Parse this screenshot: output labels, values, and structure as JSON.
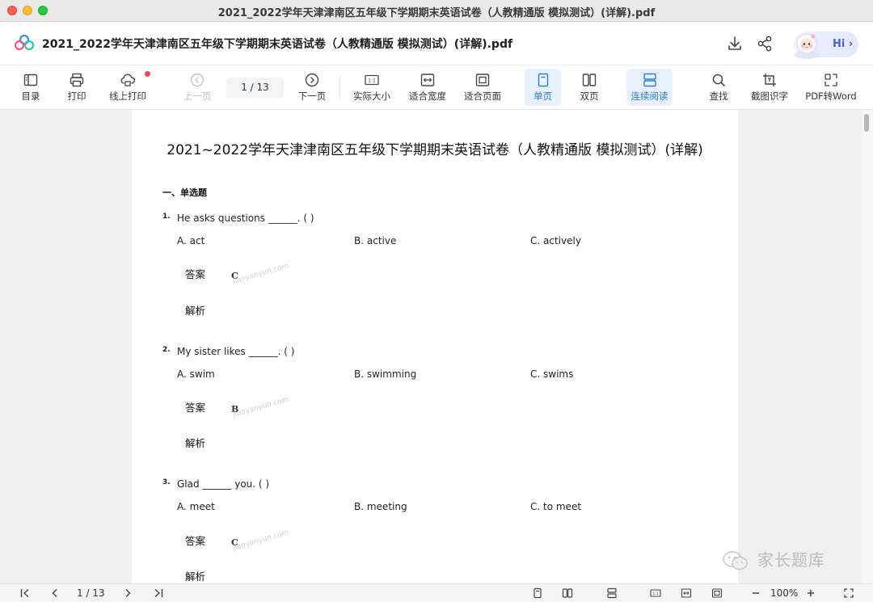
{
  "window": {
    "title": "2021_2022学年天津津南区五年级下学期期末英语试卷（人教精通版 模拟测试）(详解).pdf"
  },
  "header": {
    "doc_title": "2021_2022学年天津津南区五年级下学期期末英语试卷（人教精通版 模拟测试）(详解).pdf",
    "hi_label": "Hi",
    "hi_chevron": "›"
  },
  "toolbar": {
    "catalog": "目录",
    "print": "打印",
    "online_print": "线上打印",
    "prev_page": "上一页",
    "page_indicator": "1   /  13",
    "next_page": "下一页",
    "actual_size": "实际大小",
    "fit_width": "适合宽度",
    "fit_page": "适合页面",
    "single_page": "单页",
    "double_page": "双页",
    "continuous": "连续阅读",
    "find": "查找",
    "ocr": "截图识字",
    "pdf_to_word": "PDF转Word"
  },
  "document": {
    "title": "2021~2022学年天津津南区五年级下学期期末英语试卷（人教精通版 模拟测试）(详解)",
    "section": "一、单选题",
    "answer_label": "答案",
    "analysis_label": "解析",
    "watermark": "jiaoyanyun.com",
    "questions": [
      {
        "num": "1.",
        "text": "He asks questions ______. (     )",
        "options": [
          "A. act",
          "B. active",
          "C. actively"
        ],
        "answer": "C"
      },
      {
        "num": "2.",
        "text": "My sister likes ______. (     )",
        "options": [
          "A. swim",
          "B. swimming",
          "C. swims"
        ],
        "answer": "B"
      },
      {
        "num": "3.",
        "text": "Glad ______ you. (     )",
        "options": [
          "A. meet",
          "B. meeting",
          "C. to meet"
        ],
        "answer": "C"
      }
    ]
  },
  "brand_watermark": "家长题库",
  "bottombar": {
    "page_indicator": "1  / 13",
    "zoom": "100%"
  },
  "colors": {
    "accent": "#2a7be4",
    "active_bg": "#e8f1fd",
    "notify_dot": "#f2455b"
  }
}
